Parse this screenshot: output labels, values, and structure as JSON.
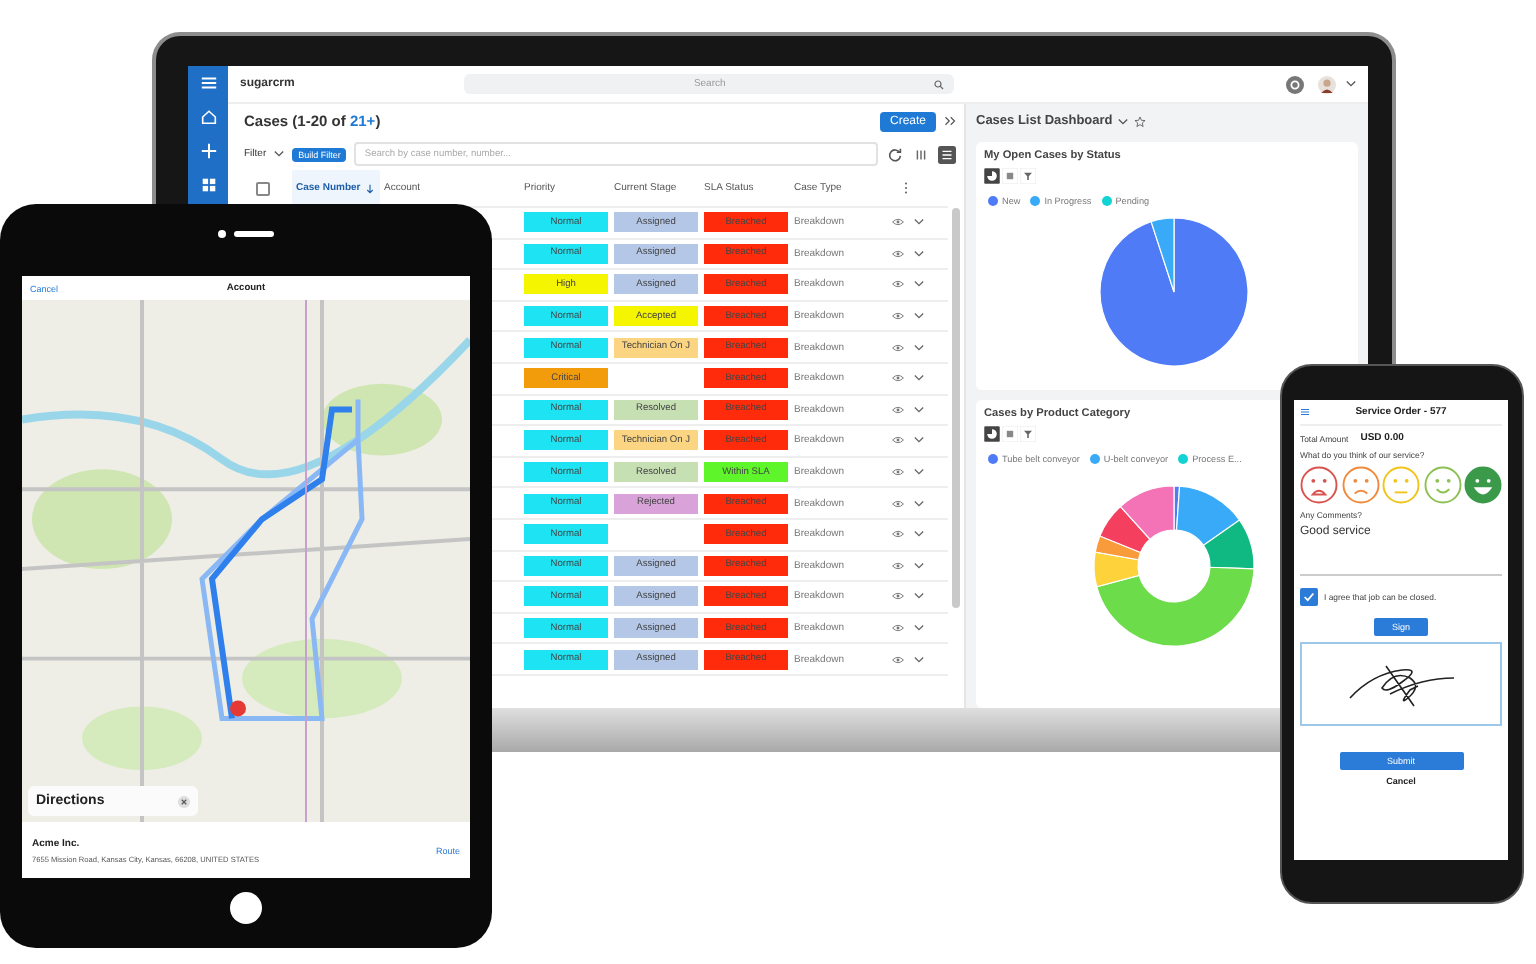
{
  "laptop": {
    "topbar": {
      "logo": "sugarcrm",
      "search_placeholder": "Search"
    },
    "sidebar": [
      {
        "kind": "menu"
      },
      {
        "kind": "home"
      },
      {
        "kind": "add"
      },
      {
        "kind": "grid"
      }
    ],
    "list": {
      "title": "Cases (1-20 of ",
      "count": "21+",
      "title_end": ")",
      "create": "Create",
      "filter": "Filter",
      "build_filter": "Build Filter",
      "search_placeholder": "Search by case number, number...",
      "views": [
        {
          "kind": "columns",
          "selected": false
        },
        {
          "kind": "list",
          "selected": true
        }
      ],
      "select_all": {
        "checked": false
      },
      "columns": [
        {
          "label": "Case Number",
          "sorted": true
        },
        {
          "label": "Account",
          "sorted": false
        },
        {
          "label": "Priority",
          "sorted": false
        },
        {
          "label": "Current Stage",
          "sorted": false
        },
        {
          "label": "SLA Status",
          "sorted": false
        },
        {
          "label": "Case Type",
          "sorted": false
        }
      ],
      "rows": [
        {
          "priority": {
            "label": "Normal",
            "color": "#1ee3f2"
          },
          "stage": {
            "label": "Assigned",
            "color": "#b4c7e7"
          },
          "sla": {
            "label": "Breached",
            "color": "#ff2b0a"
          },
          "type": "Breakdown"
        },
        {
          "priority": {
            "label": "Normal",
            "color": "#1ee3f2"
          },
          "stage": {
            "label": "Assigned",
            "color": "#b4c7e7"
          },
          "sla": {
            "label": "Breached",
            "color": "#ff2b0a"
          },
          "type": "Breakdown"
        },
        {
          "priority": {
            "label": "High",
            "color": "#f5f500"
          },
          "stage": {
            "label": "Assigned",
            "color": "#b4c7e7"
          },
          "sla": {
            "label": "Breached",
            "color": "#ff2b0a"
          },
          "type": "Breakdown"
        },
        {
          "priority": {
            "label": "Normal",
            "color": "#1ee3f2"
          },
          "stage": {
            "label": "Accepted",
            "color": "#f5f500"
          },
          "sla": {
            "label": "Breached",
            "color": "#ff2b0a"
          },
          "type": "Breakdown"
        },
        {
          "priority": {
            "label": "Normal",
            "color": "#1ee3f2"
          },
          "stage": {
            "label": "Technician On J",
            "color": "#fcd582"
          },
          "sla": {
            "label": "Breached",
            "color": "#ff2b0a"
          },
          "type": "Breakdown"
        },
        {
          "priority": {
            "label": "Critical",
            "color": "#f29c0c"
          },
          "sla": {
            "label": "Breached",
            "color": "#ff2b0a"
          },
          "type": "Breakdown"
        },
        {
          "priority": {
            "label": "Normal",
            "color": "#1ee3f2"
          },
          "stage": {
            "label": "Resolved",
            "color": "#c6e0b4"
          },
          "sla": {
            "label": "Breached",
            "color": "#ff2b0a"
          },
          "type": "Breakdown"
        },
        {
          "priority": {
            "label": "Normal",
            "color": "#1ee3f2"
          },
          "stage": {
            "label": "Technician On J",
            "color": "#fcd582"
          },
          "sla": {
            "label": "Breached",
            "color": "#ff2b0a"
          },
          "type": "Breakdown"
        },
        {
          "priority": {
            "label": "Normal",
            "color": "#1ee3f2"
          },
          "stage": {
            "label": "Resolved",
            "color": "#c6e0b4"
          },
          "sla": {
            "label": "Within SLA",
            "color": "#5ef52a"
          },
          "type": "Breakdown"
        },
        {
          "priority": {
            "label": "Normal",
            "color": "#1ee3f2"
          },
          "stage": {
            "label": "Rejected",
            "color": "#d9a3d9"
          },
          "sla": {
            "label": "Breached",
            "color": "#ff2b0a"
          },
          "type": "Breakdown"
        },
        {
          "priority": {
            "label": "Normal",
            "color": "#1ee3f2"
          },
          "sla": {
            "label": "Breached",
            "color": "#ff2b0a"
          },
          "type": "Breakdown"
        },
        {
          "priority": {
            "label": "Normal",
            "color": "#1ee3f2"
          },
          "stage": {
            "label": "Assigned",
            "color": "#b4c7e7"
          },
          "sla": {
            "label": "Breached",
            "color": "#ff2b0a"
          },
          "type": "Breakdown"
        },
        {
          "priority": {
            "label": "Normal",
            "color": "#1ee3f2"
          },
          "stage": {
            "label": "Assigned",
            "color": "#b4c7e7"
          },
          "sla": {
            "label": "Breached",
            "color": "#ff2b0a"
          },
          "type": "Breakdown"
        },
        {
          "priority": {
            "label": "Normal",
            "color": "#1ee3f2"
          },
          "stage": {
            "label": "Assigned",
            "color": "#b4c7e7"
          },
          "sla": {
            "label": "Breached",
            "color": "#ff2b0a"
          },
          "type": "Breakdown"
        },
        {
          "priority": {
            "label": "Normal",
            "color": "#1ee3f2"
          },
          "stage": {
            "label": "Assigned",
            "color": "#b4c7e7"
          },
          "sla": {
            "label": "Breached",
            "color": "#ff2b0a"
          },
          "type": "Breakdown"
        }
      ]
    },
    "dashboard": {
      "title": "Cases List Dashboard",
      "dashlets": [
        {
          "title": "My Open Cases by Status",
          "kind": "pie",
          "tools": [
            {
              "kind": "chart",
              "selected": true
            },
            {
              "kind": "table",
              "selected": false
            },
            {
              "kind": "filter",
              "selected": false
            }
          ],
          "legend": [
            {
              "label": "New",
              "color": "#4f7cf6"
            },
            {
              "label": "In Progress",
              "color": "#38aaf8"
            },
            {
              "label": "Pending",
              "color": "#12d3d3"
            }
          ]
        },
        {
          "title": "Cases by Product Category",
          "kind": "donut",
          "tools": [
            {
              "kind": "chart",
              "selected": true
            },
            {
              "kind": "table",
              "selected": false
            },
            {
              "kind": "filter",
              "selected": false
            }
          ],
          "legend": [
            {
              "label": "Tube belt conveyor",
              "color": "#4f7cf6"
            },
            {
              "label": "U-belt conveyor",
              "color": "#38aaf8"
            },
            {
              "label": "Process E...",
              "color": "#12d3d3"
            }
          ]
        }
      ]
    }
  },
  "tablet": {
    "cancel": "Cancel",
    "title": "Account",
    "directions": "Directions",
    "account_name": "Acme Inc.",
    "address": "7655 Mission Road, Kansas City, Kansas, 66208, UNITED STATES",
    "route": "Route"
  },
  "phone": {
    "title": "Service Order - 577",
    "total_label": "Total Amount",
    "total": "USD 0.00",
    "question": "What do you think of our service?",
    "faces": [
      {
        "kind": "very_sad",
        "color": "#d9534f",
        "selected": false
      },
      {
        "kind": "sad",
        "color": "#ef8a3c",
        "selected": false
      },
      {
        "kind": "neutral",
        "color": "#f0c419",
        "selected": false
      },
      {
        "kind": "happy",
        "color": "#8cc152",
        "selected": false
      },
      {
        "kind": "very_happy",
        "color": "#3a9a4a",
        "selected": true
      }
    ],
    "comments_label": "Any Comments?",
    "comments": "Good service",
    "agree": {
      "label": "I agree that job can be closed.",
      "checked": true
    },
    "sign": "Sign",
    "submit": "Submit",
    "cancel": "Cancel"
  }
}
